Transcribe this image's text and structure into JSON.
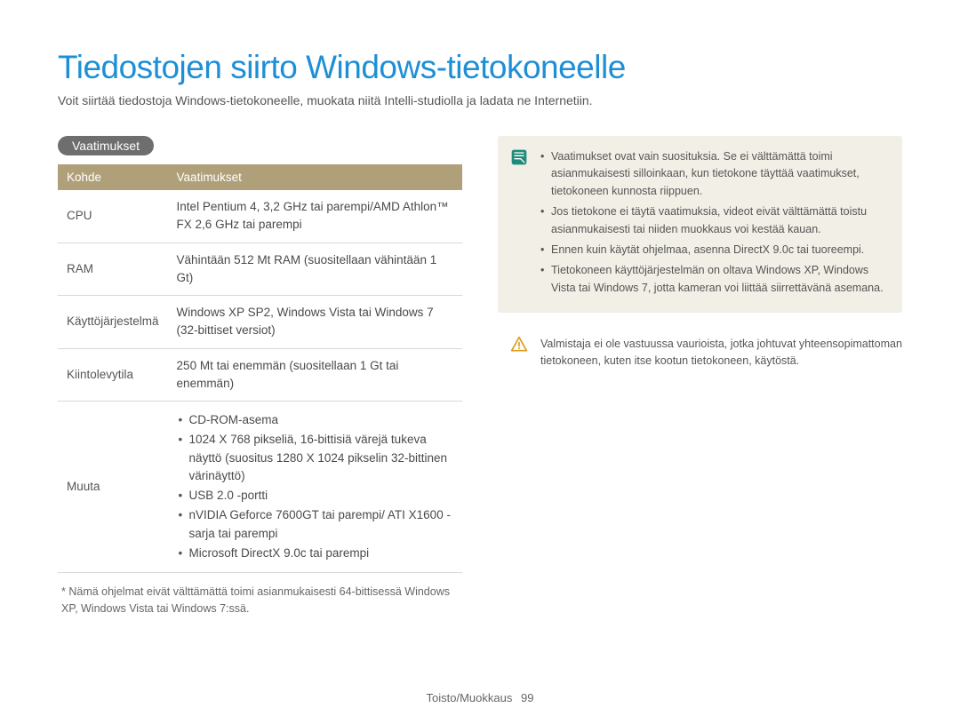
{
  "title": "Tiedostojen siirto Windows-tietokoneelle",
  "intro": "Voit siirtää tiedostoja Windows-tietokoneelle, muokata niitä Intelli-studiolla ja ladata ne Internetiin.",
  "section_heading": "Vaatimukset",
  "table": {
    "headers": [
      "Kohde",
      "Vaatimukset"
    ],
    "rows": [
      {
        "label": "CPU",
        "value": "Intel Pentium 4, 3,2 GHz tai parempi/AMD Athlon™ FX 2,6 GHz tai parempi"
      },
      {
        "label": "RAM",
        "value": "Vähintään 512 Mt RAM (suositellaan vähintään 1 Gt)"
      },
      {
        "label": "Käyttöjärjestelmä",
        "value": "Windows XP SP2, Windows Vista tai Windows 7 (32-bittiset versiot)"
      },
      {
        "label": "Kiintolevytila",
        "value": "250 Mt tai enemmän (suositellaan 1 Gt tai enemmän)"
      }
    ],
    "other_label": "Muuta",
    "other_items": [
      "CD-ROM-asema",
      "1024 X 768 pikseliä, 16-bittisiä värejä tukeva näyttö (suositus 1280 X 1024 pikselin 32-bittinen värinäyttö)",
      "USB 2.0 -portti",
      "nVIDIA Geforce 7600GT tai parempi/ ATI X1600 -sarja tai parempi",
      "Microsoft DirectX 9.0c tai parempi"
    ]
  },
  "footnote": "* Nämä ohjelmat eivät välttämättä toimi asianmukaisesti 64-bittisessä Windows XP, Windows Vista tai Windows 7:ssä.",
  "info_notes": [
    "Vaatimukset ovat vain suosituksia. Se ei välttämättä toimi asianmukaisesti silloinkaan, kun tietokone täyttää vaatimukset, tietokoneen kunnosta riippuen.",
    "Jos tietokone ei täytä vaatimuksia, videot eivät välttämättä toistu asianmukaisesti tai niiden muokkaus voi kestää kauan.",
    "Ennen kuin käytät ohjelmaa, asenna DirectX 9.0c tai tuoreempi.",
    "Tietokoneen käyttöjärjestelmän on oltava Windows XP, Windows Vista tai Windows 7, jotta kameran voi liittää siirrettävänä asemana."
  ],
  "warning_text": "Valmistaja ei ole vastuussa vaurioista, jotka johtuvat yhteensopimattoman tietokoneen, kuten itse kootun tietokoneen, käytöstä.",
  "footer": {
    "section": "Toisto/Muokkaus",
    "page": "99"
  }
}
